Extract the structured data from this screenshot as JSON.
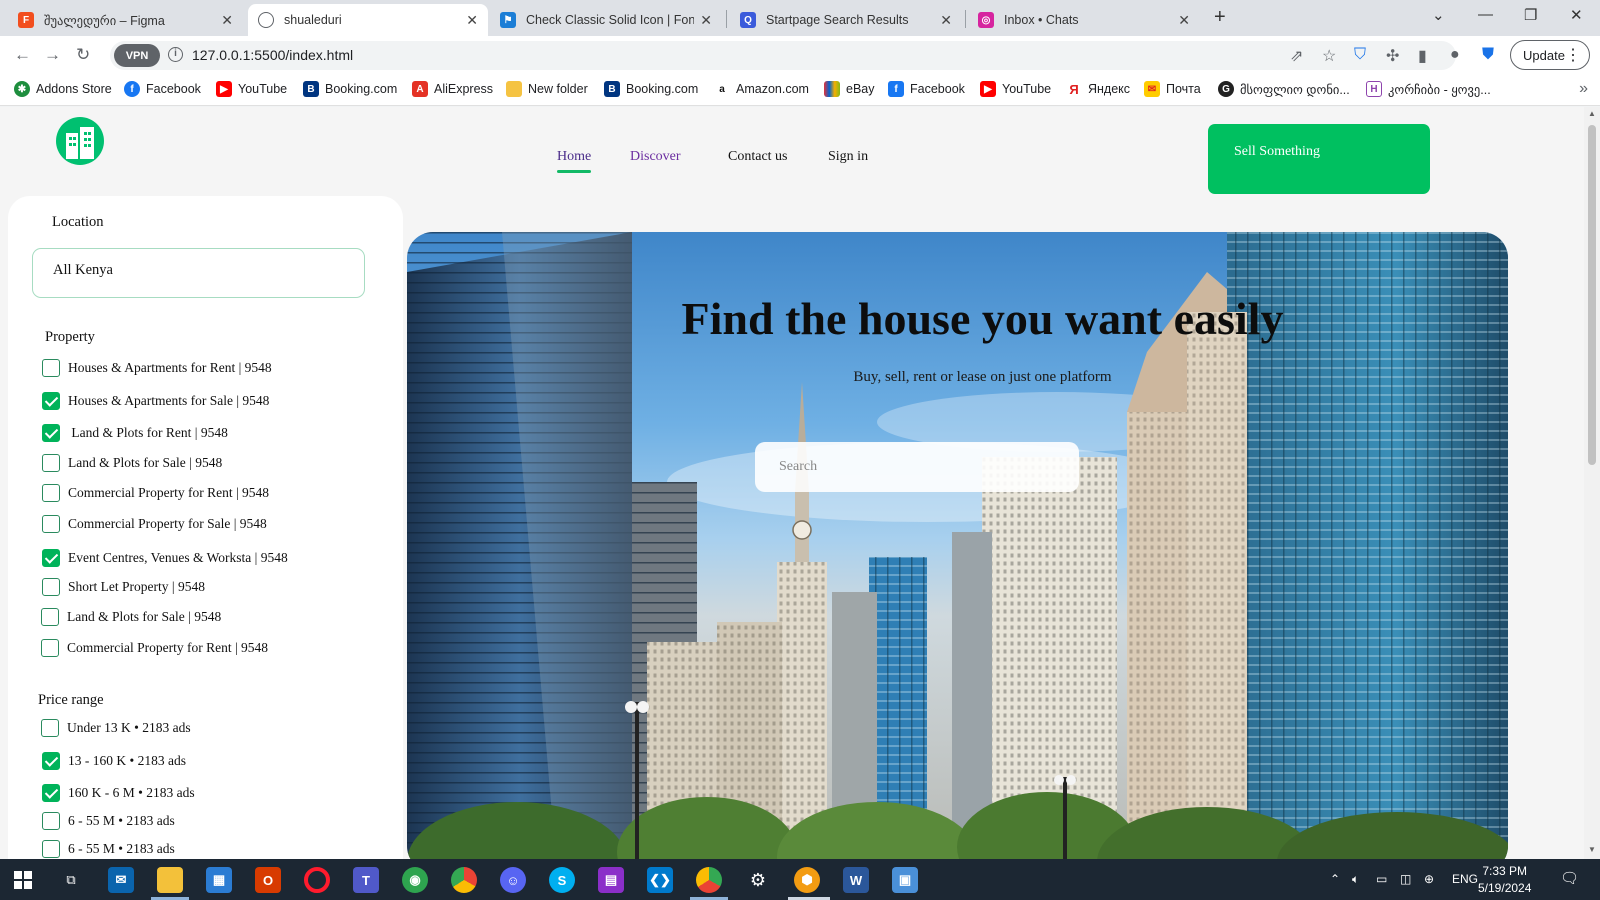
{
  "browser": {
    "tabs": [
      {
        "title": "შუალედური – Figma",
        "icon": "figma-icon",
        "color": "#f24e1e"
      },
      {
        "title": "shualeduri",
        "icon": "globe-icon",
        "color": "#5f6368",
        "active": true
      },
      {
        "title": "Check Classic Solid Icon | Font A",
        "icon": "font-awesome-icon",
        "color": "#1c7ed6"
      },
      {
        "title": "Startpage Search Results",
        "icon": "search-icon",
        "color": "#3b5bdb"
      },
      {
        "title": "Inbox • Chats",
        "icon": "instagram-icon",
        "color": "#d6249f"
      }
    ],
    "url": "127.0.0.1:5500/index.html",
    "vpn_label": "VPN",
    "update_label": "Update",
    "bookmarks": [
      {
        "label": "Addons Store",
        "icon": "addons-store-icon",
        "color": "#1e8e3e",
        "glyph": "✱"
      },
      {
        "label": "Facebook",
        "icon": "facebook-icon",
        "color": "#1877f2",
        "glyph": "f"
      },
      {
        "label": "YouTube",
        "icon": "youtube-icon",
        "color": "#ff0000",
        "glyph": "▶"
      },
      {
        "label": "Booking.com",
        "icon": "booking-icon",
        "color": "#003580",
        "glyph": "B"
      },
      {
        "label": "AliExpress",
        "icon": "aliexpress-icon",
        "color": "#e43225",
        "glyph": "A"
      },
      {
        "label": "New folder",
        "icon": "folder-icon",
        "color": "#f5c342",
        "glyph": ""
      },
      {
        "label": "Booking.com",
        "icon": "booking-icon",
        "color": "#003580",
        "glyph": "B"
      },
      {
        "label": "Amazon.com",
        "icon": "amazon-icon",
        "color": "#ffffff",
        "glyph": "a"
      },
      {
        "label": "eBay",
        "icon": "ebay-icon",
        "color": "#86b817",
        "glyph": "e"
      },
      {
        "label": "Facebook",
        "icon": "facebook-icon",
        "color": "#1877f2",
        "glyph": "f"
      },
      {
        "label": "YouTube",
        "icon": "youtube-icon",
        "color": "#ff0000",
        "glyph": "▶"
      },
      {
        "label": "Яндекс",
        "icon": "yandex-icon",
        "color": "#ffffff",
        "glyph": "Я"
      },
      {
        "label": "Почта",
        "icon": "mail-icon",
        "color": "#ffcc00",
        "glyph": "✉"
      },
      {
        "label": "მსოფლიო დონი...",
        "icon": "site-icon",
        "color": "#222222",
        "glyph": "G"
      },
      {
        "label": "კორჩიბი - ყოვე...",
        "icon": "site-icon",
        "color": "#8e44ad",
        "glyph": "H"
      }
    ]
  },
  "header": {
    "nav": [
      "Home",
      "Discover",
      "Contact us",
      "Sign in"
    ],
    "sell_button": "Sell Something",
    "accent_color": "#00c060"
  },
  "sidebar": {
    "location_label": "Location",
    "location_value": "All Kenya",
    "property_title": "Property",
    "property_items": [
      {
        "label": "Houses & Apartments for Rent",
        "count": "| 9548",
        "checked": false
      },
      {
        "label": "Houses & Apartments for Sale",
        "count": "| 9548",
        "checked": true
      },
      {
        "label": "Land & Plots for Rent",
        "count": "| 9548",
        "checked": true
      },
      {
        "label": "Land & Plots for Sale",
        "count": "| 9548",
        "checked": false
      },
      {
        "label": "Commercial Property for Rent",
        "count": "| 9548",
        "checked": false
      },
      {
        "label": "Commercial Property for Sale",
        "count": "| 9548",
        "checked": false
      },
      {
        "label": "Event Centres, Venues & Worksta",
        "count": "| 9548",
        "checked": true
      },
      {
        "label": "Short Let Property",
        "count": "| 9548",
        "checked": false
      },
      {
        "label": "Land & Plots for Sale",
        "count": "| 9548",
        "checked": false
      },
      {
        "label": "Commercial Property for Rent",
        "count": "| 9548",
        "checked": false
      }
    ],
    "price_title": "Price range",
    "price_items": [
      {
        "label": "Under 13 K • 2183 ads",
        "checked": false
      },
      {
        "label": "13 - 160 K • 2183 ads",
        "checked": true
      },
      {
        "label": "160 K - 6 M • 2183 ads",
        "checked": true
      },
      {
        "label": "6 - 55 M • 2183 ads",
        "checked": false
      },
      {
        "label": "6 - 55 M • 2183 ads",
        "checked": false
      }
    ]
  },
  "hero": {
    "title": "Find the house you want easily",
    "subtitle": "Buy, sell, rent or lease on just one platform",
    "search_placeholder": "Search"
  },
  "taskbar": {
    "apps": [
      {
        "icon": "mail-app-icon",
        "color": "#0a64ad"
      },
      {
        "icon": "file-explorer-icon",
        "color": "#f3c13a"
      },
      {
        "icon": "microsoft-store-icon",
        "color": "#2b7cd3"
      },
      {
        "icon": "office-icon",
        "color": "#d83b01"
      },
      {
        "icon": "opera-icon",
        "color": "#ff1b2d"
      },
      {
        "icon": "teams-icon",
        "color": "#5059c9"
      },
      {
        "icon": "maps-icon",
        "color": "#2ea44f"
      },
      {
        "icon": "chrome-icon",
        "color": "#fbbc04"
      },
      {
        "icon": "discord-icon",
        "color": "#5865f2"
      },
      {
        "icon": "skype-icon",
        "color": "#00aff0"
      },
      {
        "icon": "winrar-icon",
        "color": "#8b2fc9"
      },
      {
        "icon": "vscode-icon",
        "color": "#007acc"
      },
      {
        "icon": "chrome-icon",
        "color": "#34a853"
      },
      {
        "icon": "settings-icon",
        "color": "#6b6b6b"
      },
      {
        "icon": "browser-icon",
        "color": "#f39c12"
      },
      {
        "icon": "word-icon",
        "color": "#2b579a"
      },
      {
        "icon": "app-icon",
        "color": "#4a90d9"
      }
    ],
    "language": "ENG",
    "time": "7:33 PM",
    "date": "5/19/2024"
  }
}
